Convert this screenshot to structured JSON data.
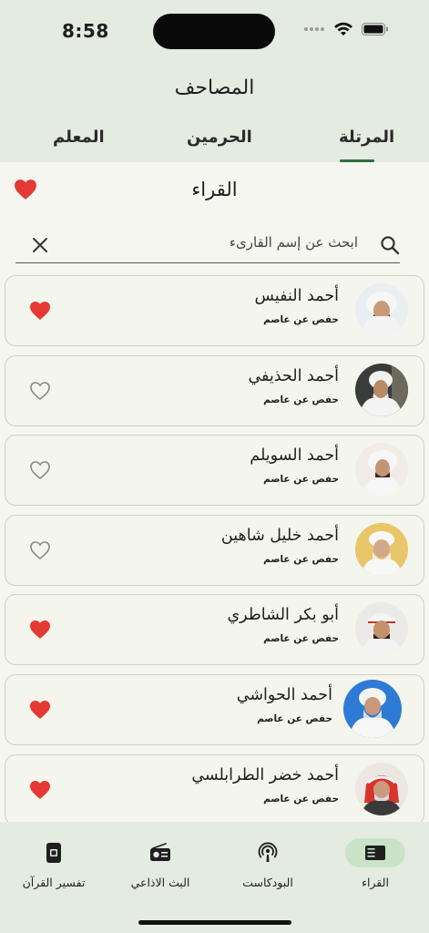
{
  "status_bar": {
    "time": "8:58"
  },
  "header": {
    "title": "المصاحف"
  },
  "tabs": [
    {
      "label": "المرتلة",
      "active": true
    },
    {
      "label": "الحرمين",
      "active": false
    },
    {
      "label": "المعلم",
      "active": false
    }
  ],
  "sheet": {
    "title": "القراء"
  },
  "search": {
    "placeholder": "ابحث عن إسم القارىء",
    "value": ""
  },
  "reciters": [
    {
      "name": "أحمد النفيس",
      "riwaya": "حفص عن عاصم",
      "favorite": true
    },
    {
      "name": "أحمد  الحذيفي",
      "riwaya": "حفص عن عاصم",
      "favorite": false
    },
    {
      "name": "أحمد السويلم",
      "riwaya": "حفص عن عاصم",
      "favorite": false
    },
    {
      "name": "أحمد خليل شاهين",
      "riwaya": "حفص عن عاصم",
      "favorite": false
    },
    {
      "name": "أبو بكر الشاطري",
      "riwaya": "حفص عن عاصم",
      "favorite": true
    },
    {
      "name": "أحمد الحواشي",
      "riwaya": "حفص عن عاصم",
      "favorite": true
    },
    {
      "name": "أحمد خضر الطرابلسي",
      "riwaya": "حفص عن عاصم",
      "favorite": true
    }
  ],
  "bottom_nav": [
    {
      "label": "القراء",
      "icon": "quran-book-icon",
      "active": true
    },
    {
      "label": "البودكاست",
      "icon": "podcast-icon",
      "active": false
    },
    {
      "label": "البث الاذاعي",
      "icon": "radio-icon",
      "active": false
    },
    {
      "label": "تفسير القرآن",
      "icon": "tafsir-phone-icon",
      "active": false
    }
  ],
  "colors": {
    "heart": "#e53935",
    "accent": "#2f6f3f",
    "nav_active": "#c8e3c7"
  }
}
